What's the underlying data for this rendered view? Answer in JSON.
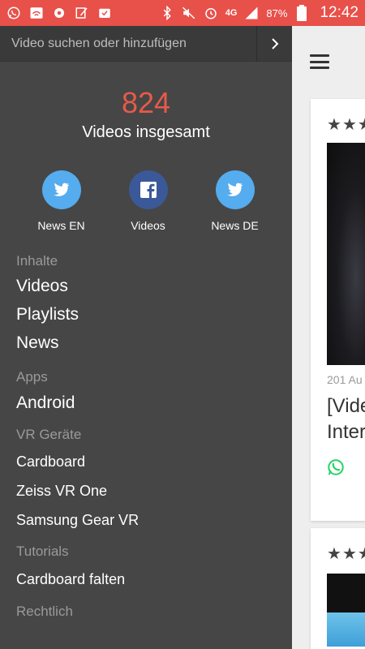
{
  "status_bar": {
    "network": "4G",
    "battery_percent": "87%",
    "time": "12:42"
  },
  "drawer": {
    "search": {
      "placeholder": "Video suchen oder hinzufügen"
    },
    "count": "824",
    "count_label": "Videos insgesamt",
    "social": [
      {
        "label": "News EN",
        "icon": "twitter-icon",
        "color": "#55acee"
      },
      {
        "label": "Videos",
        "icon": "facebook-icon",
        "color": "#3b5998"
      },
      {
        "label": "News DE",
        "icon": "twitter-icon",
        "color": "#55acee"
      }
    ],
    "menu": {
      "inhalte_header": "Inhalte",
      "videos": "Videos",
      "playlists": "Playlists",
      "news": "News",
      "apps_header": "Apps",
      "android": "Android",
      "vr_header": "VR Geräte",
      "cardboard": "Cardboard",
      "zeiss": "Zeiss VR One",
      "samsung": "Samsung Gear VR",
      "tutorials_header": "Tutorials",
      "cardboard_falten": "Cardboard falten",
      "rechtlich_header": "Rechtlich"
    }
  },
  "content": {
    "card1": {
      "date": "201 Au",
      "title_line1": "[Vide",
      "title_line2": "Inter"
    }
  },
  "colors": {
    "status_bar": "#e8504a",
    "accent": "#e65a4a",
    "drawer_bg": "#464646",
    "whatsapp": "#25d366"
  }
}
